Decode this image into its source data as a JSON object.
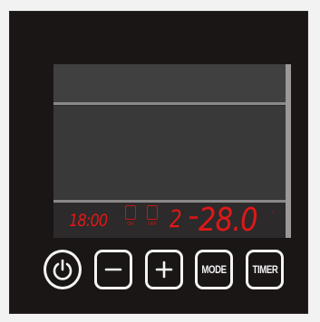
{
  "panel": {
    "readout": {
      "time": "18:00",
      "on_label": "ON",
      "off_label": "OFF",
      "level": "2",
      "temperature": "28.0",
      "unit": "°"
    },
    "buttons": {
      "power_icon": "power-icon",
      "minus_icon": "minus-icon",
      "plus_icon": "plus-icon",
      "mode_label": "MODE",
      "timer_label": "TIMER"
    }
  },
  "colors": {
    "frame": "#1a1616",
    "display": "#3a3939",
    "segment_red": "#e01818",
    "button_outline": "#f4f4f4"
  }
}
